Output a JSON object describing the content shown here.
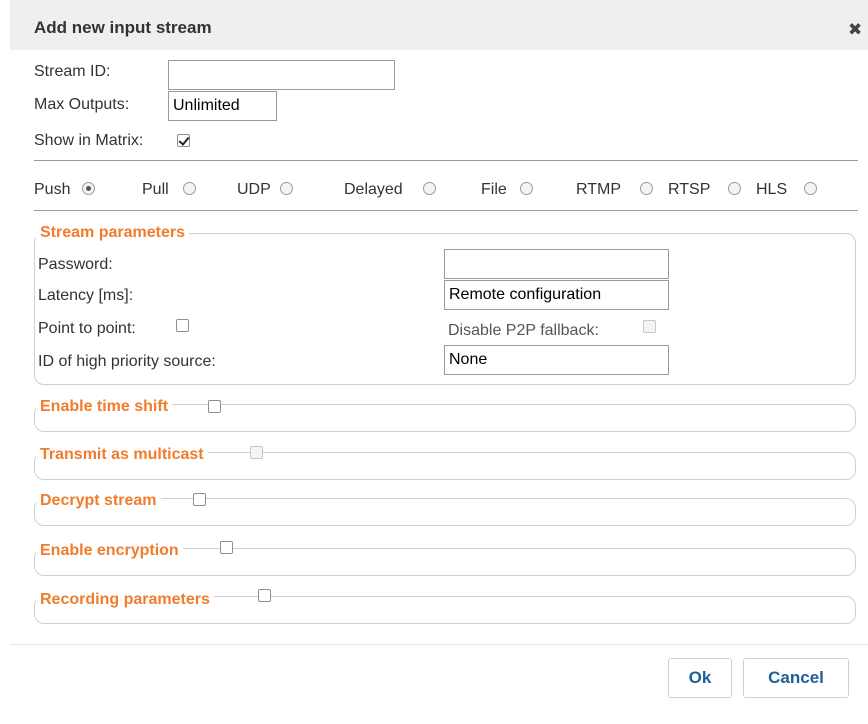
{
  "dialog": {
    "title": "Add new input stream",
    "close_icon": "close-icon",
    "close_glyph": "✖"
  },
  "fields": {
    "stream_id_label": "Stream ID:",
    "stream_id_value": "",
    "max_outputs_label": "Max Outputs:",
    "max_outputs_value": "Unlimited",
    "show_in_matrix_label": "Show in Matrix:",
    "show_in_matrix_checked": true
  },
  "stream_types": [
    {
      "label": "Push",
      "selected": true
    },
    {
      "label": "Pull",
      "selected": false
    },
    {
      "label": "UDP",
      "selected": false
    },
    {
      "label": "Delayed",
      "selected": false
    },
    {
      "label": "File",
      "selected": false
    },
    {
      "label": "RTMP",
      "selected": false
    },
    {
      "label": "RTSP",
      "selected": false
    },
    {
      "label": "HLS",
      "selected": false
    }
  ],
  "stream_parameters": {
    "legend": "Stream parameters",
    "password_label": "Password:",
    "password_value": "",
    "latency_label": "Latency [ms]:",
    "latency_value": "Remote configuration",
    "p2p_label": "Point to point:",
    "p2p_fallback_label": "Disable P2P fallback:",
    "priority_source_label": "ID of high priority source:",
    "priority_source_value": "None"
  },
  "sections": {
    "time_shift": "Enable time shift",
    "multicast": "Transmit as multicast",
    "decrypt": "Decrypt stream",
    "encryption": "Enable encryption",
    "recording": "Recording parameters"
  },
  "buttons": {
    "ok": "Ok",
    "cancel": "Cancel"
  },
  "colors": {
    "accent": "#f07c2c",
    "button_text": "#1f5f9a",
    "titlebar": "#efefef"
  }
}
